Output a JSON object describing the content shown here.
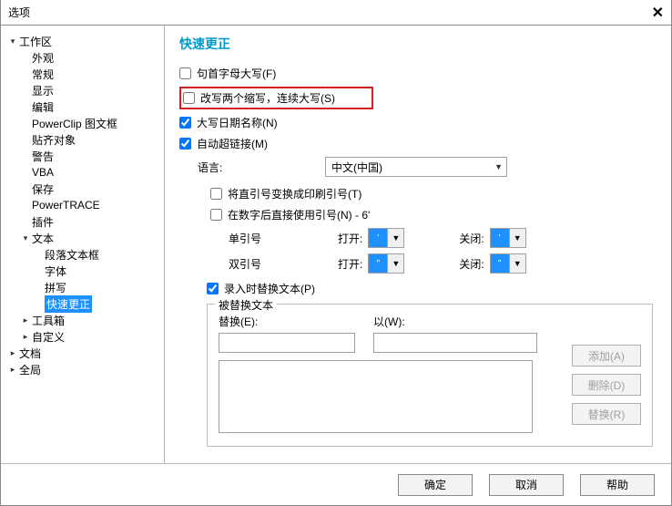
{
  "title": "选项",
  "sidebar": {
    "items": [
      {
        "label": "工作区",
        "depth": 0,
        "caret": "▾"
      },
      {
        "label": "外观",
        "depth": 1,
        "caret": ""
      },
      {
        "label": "常规",
        "depth": 1,
        "caret": ""
      },
      {
        "label": "显示",
        "depth": 1,
        "caret": ""
      },
      {
        "label": "编辑",
        "depth": 1,
        "caret": ""
      },
      {
        "label": "PowerClip 图文框",
        "depth": 1,
        "caret": ""
      },
      {
        "label": "贴齐对象",
        "depth": 1,
        "caret": ""
      },
      {
        "label": "警告",
        "depth": 1,
        "caret": ""
      },
      {
        "label": "VBA",
        "depth": 1,
        "caret": ""
      },
      {
        "label": "保存",
        "depth": 1,
        "caret": ""
      },
      {
        "label": "PowerTRACE",
        "depth": 1,
        "caret": ""
      },
      {
        "label": "插件",
        "depth": 1,
        "caret": ""
      },
      {
        "label": "文本",
        "depth": 1,
        "caret": "▾"
      },
      {
        "label": "段落文本框",
        "depth": 2,
        "caret": ""
      },
      {
        "label": "字体",
        "depth": 2,
        "caret": ""
      },
      {
        "label": "拼写",
        "depth": 2,
        "caret": ""
      },
      {
        "label": "快速更正",
        "depth": 2,
        "caret": "",
        "selected": true
      },
      {
        "label": "工具箱",
        "depth": 1,
        "caret": "▸"
      },
      {
        "label": "自定义",
        "depth": 1,
        "caret": "▸"
      },
      {
        "label": "文档",
        "depth": 0,
        "caret": "▸"
      },
      {
        "label": "全局",
        "depth": 0,
        "caret": "▸"
      }
    ]
  },
  "content": {
    "heading": "快速更正",
    "chk1": "句首字母大写(F)",
    "chk2": "改写两个缩写，连续大写(S)",
    "chk3": "大写日期名称(N)",
    "chk4": "自动超链接(M)",
    "lang_label": "语言:",
    "lang_value": "中文(中国)",
    "chk5": "将直引号变换成印刷引号(T)",
    "chk6_pre": "在数字后直接使用引号(N) - 6",
    "chk6_mark": "'",
    "single_quote": "单引号",
    "double_quote": "双引号",
    "open_label": "打开:",
    "close_label": "关闭:",
    "open_single": "'",
    "close_single": "'",
    "open_double": "\"",
    "close_double": "\"",
    "chk7": "录入时替换文本(P)",
    "fieldset_legend": "被替换文本",
    "col_replace": "替换(E):",
    "col_with": "以(W):",
    "btn_add": "添加(A)",
    "btn_del": "删除(D)",
    "btn_rep": "替换(R)"
  },
  "footer": {
    "ok": "确定",
    "cancel": "取消",
    "help": "帮助"
  }
}
